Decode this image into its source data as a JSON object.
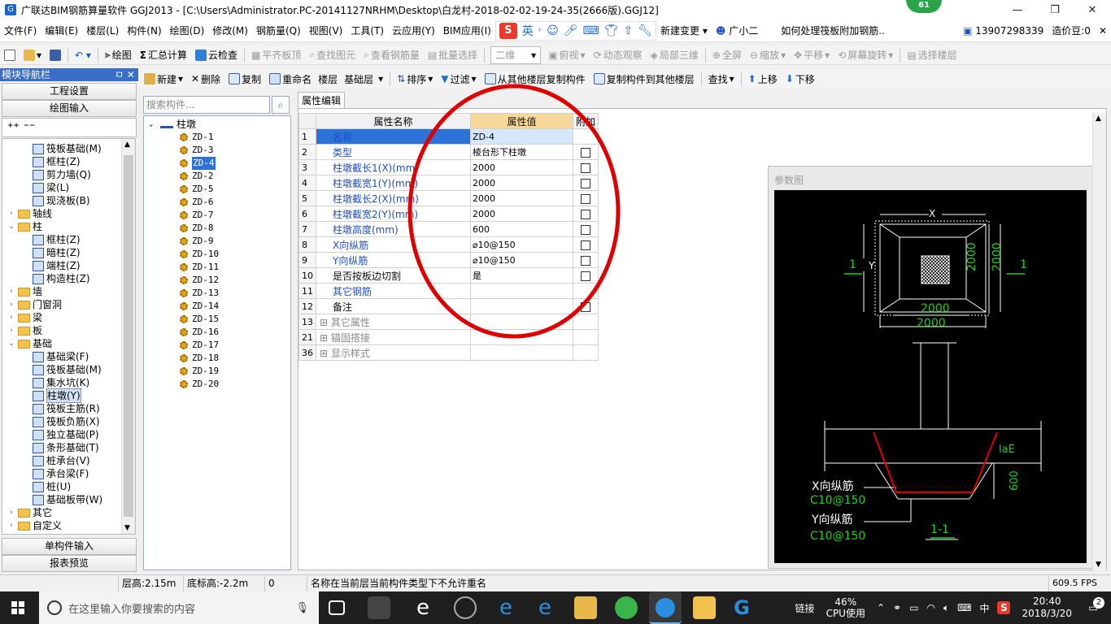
{
  "titlebar": {
    "title": "广联达BIM钢筋算量软件 GGJ2013 - [C:\\Users\\Administrator.PC-20141127NRHM\\Desktop\\白龙村-2018-02-02-19-24-35(2666版).GGJ12]",
    "badge": "61",
    "min": "—",
    "max": "❐",
    "close": "✕"
  },
  "menu": {
    "items": [
      "文件(F)",
      "编辑(E)",
      "楼层(L)",
      "构件(N)",
      "绘图(D)",
      "修改(M)",
      "钢筋量(Q)",
      "视图(V)",
      "工具(T)",
      "云应用(Y)",
      "BIM应用(I)"
    ],
    "ime_label": "英",
    "new_change": "新建变更",
    "assistant": "广小二",
    "question": "如何处理筏板附加钢筋..",
    "phone": "13907298339",
    "beans": "造价豆:0"
  },
  "toolbar1": {
    "draw": "绘图",
    "sum": "汇总计算",
    "cloud_check": "云检查",
    "flush": "平齐板顶",
    "find_elem": "查找图元",
    "view_rebar": "查看钢筋量",
    "batch_select": "批量选择",
    "view_mode": "二维",
    "top_view": "俯视",
    "dynamic": "动态观察",
    "local3d": "局部三维",
    "fullscreen": "全屏",
    "zoom": "缩放",
    "pan": "平移",
    "rotate": "屏幕旋转",
    "select_floor": "选择楼层"
  },
  "toolbar2": {
    "new": "新建",
    "delete": "删除",
    "copy": "复制",
    "rename": "重命名",
    "floor_label": "楼层",
    "floor_value": "基础层",
    "sort": "排序",
    "filter": "过滤",
    "copy_from": "从其他楼层复制构件",
    "copy_to": "复制构件到其他楼层",
    "find": "查找",
    "up": "上移",
    "down": "下移"
  },
  "nav": {
    "header": "模块导航栏",
    "pin": "ㅁ ✕",
    "project_settings": "工程设置",
    "drawing_input": "绘图输入",
    "single_input": "单构件输入",
    "report": "报表预览",
    "tree": [
      {
        "label": "筏板基础(M)",
        "level": 2,
        "kind": "item"
      },
      {
        "label": "框柱(Z)",
        "level": 2,
        "kind": "item"
      },
      {
        "label": "剪力墙(Q)",
        "level": 2,
        "kind": "item"
      },
      {
        "label": "梁(L)",
        "level": 2,
        "kind": "item"
      },
      {
        "label": "现浇板(B)",
        "level": 2,
        "kind": "item"
      },
      {
        "label": "轴线",
        "level": 1,
        "kind": "folder",
        "exp": "›"
      },
      {
        "label": "柱",
        "level": 1,
        "kind": "folder",
        "exp": "⌄"
      },
      {
        "label": "框柱(Z)",
        "level": 2,
        "kind": "item"
      },
      {
        "label": "暗柱(Z)",
        "level": 2,
        "kind": "item"
      },
      {
        "label": "端柱(Z)",
        "level": 2,
        "kind": "item"
      },
      {
        "label": "构造柱(Z)",
        "level": 2,
        "kind": "item"
      },
      {
        "label": "墙",
        "level": 1,
        "kind": "folder",
        "exp": "›"
      },
      {
        "label": "门窗洞",
        "level": 1,
        "kind": "folder",
        "exp": "›"
      },
      {
        "label": "梁",
        "level": 1,
        "kind": "folder",
        "exp": "›"
      },
      {
        "label": "板",
        "level": 1,
        "kind": "folder",
        "exp": "›"
      },
      {
        "label": "基础",
        "level": 1,
        "kind": "folder",
        "exp": "⌄"
      },
      {
        "label": "基础梁(F)",
        "level": 2,
        "kind": "item"
      },
      {
        "label": "筏板基础(M)",
        "level": 2,
        "kind": "item"
      },
      {
        "label": "集水坑(K)",
        "level": 2,
        "kind": "item"
      },
      {
        "label": "柱墩(Y)",
        "level": 2,
        "kind": "item",
        "selected": true
      },
      {
        "label": "筏板主筋(R)",
        "level": 2,
        "kind": "item"
      },
      {
        "label": "筏板负筋(X)",
        "level": 2,
        "kind": "item"
      },
      {
        "label": "独立基础(P)",
        "level": 2,
        "kind": "item"
      },
      {
        "label": "条形基础(T)",
        "level": 2,
        "kind": "item"
      },
      {
        "label": "桩承台(V)",
        "level": 2,
        "kind": "item"
      },
      {
        "label": "承台梁(F)",
        "level": 2,
        "kind": "item"
      },
      {
        "label": "桩(U)",
        "level": 2,
        "kind": "item"
      },
      {
        "label": "基础板带(W)",
        "level": 2,
        "kind": "item"
      },
      {
        "label": "其它",
        "level": 1,
        "kind": "folder",
        "exp": "›"
      },
      {
        "label": "自定义",
        "level": 1,
        "kind": "folder",
        "exp": "›"
      }
    ]
  },
  "components": {
    "search_placeholder": "搜索构件...",
    "root": "柱墩",
    "items": [
      "ZD-1",
      "ZD-3",
      "ZD-4",
      "ZD-2",
      "ZD-5",
      "ZD-6",
      "ZD-7",
      "ZD-8",
      "ZD-9",
      "ZD-10",
      "ZD-11",
      "ZD-12",
      "ZD-13",
      "ZD-14",
      "ZD-15",
      "ZD-16",
      "ZD-17",
      "ZD-18",
      "ZD-19",
      "ZD-20"
    ],
    "selected": "ZD-4"
  },
  "properties": {
    "tab": "属性编辑",
    "headers": {
      "name": "属性名称",
      "value": "属性值",
      "extra": "附加"
    },
    "rows": [
      {
        "no": "1",
        "name": "名称",
        "value": "ZD-4",
        "check": false,
        "selected": true
      },
      {
        "no": "2",
        "name": "类型",
        "value": "棱台形下柱墩",
        "check": true
      },
      {
        "no": "3",
        "name": "柱墩截长1(X)(mm)",
        "value": "2000",
        "check": true
      },
      {
        "no": "4",
        "name": "柱墩截宽1(Y)(mm)",
        "value": "2000",
        "check": true
      },
      {
        "no": "5",
        "name": "柱墩截长2(X)(mm)",
        "value": "2000",
        "check": true
      },
      {
        "no": "6",
        "name": "柱墩截宽2(Y)(mm)",
        "value": "2000",
        "check": true
      },
      {
        "no": "7",
        "name": "柱墩高度(mm)",
        "value": "600",
        "check": true
      },
      {
        "no": "8",
        "name": "X向纵筋",
        "value": "⌀10@150",
        "check": true
      },
      {
        "no": "9",
        "name": "Y向纵筋",
        "value": "⌀10@150",
        "check": true
      },
      {
        "no": "10",
        "name": "是否按板边切割",
        "value": "是",
        "check": true,
        "dark": true
      },
      {
        "no": "11",
        "name": "其它钢筋",
        "value": "",
        "check": false
      },
      {
        "no": "12",
        "name": "备注",
        "value": "",
        "check": true,
        "dark": true
      },
      {
        "no": "13",
        "name": "其它属性",
        "value": "",
        "check": false,
        "group": true
      },
      {
        "no": "21",
        "name": "锚固搭接",
        "value": "",
        "check": false,
        "group": true
      },
      {
        "no": "36",
        "name": "显示样式",
        "value": "",
        "check": false,
        "group": true
      }
    ]
  },
  "param_figure": {
    "title": "参数图",
    "labels": {
      "x": "X",
      "y": "Y",
      "sec_left": "1",
      "sec_right": "1",
      "dim_vert1": "2000",
      "dim_vert2": "2000",
      "dim_h1": "2000",
      "dim_h2": "2000",
      "lae": "laE",
      "h600": "600",
      "x_rebar": "X向纵筋",
      "x_spec": "C10@150",
      "y_rebar": "Y向纵筋",
      "y_spec": "C10@150",
      "section": "1-1"
    }
  },
  "status": {
    "floor_h": "层高:2.15m",
    "bottom_h": "底标高:-2.2m",
    "zero": "0",
    "message": "名称在当前层当前构件类型下不允许重名",
    "fps": "609.5 FPS"
  },
  "taskbar": {
    "search_placeholder": "在这里输入你要搜索的内容",
    "link": "链接",
    "cpu_pct": "46%",
    "cpu_label": "CPU使用",
    "lang": "中",
    "time": "20:40",
    "date": "2018/3/20",
    "notif": "2"
  },
  "colors": {
    "accent_blue": "#2c72d8",
    "header_value": "#f5d89a",
    "annotation_red": "#e00000",
    "cad_green": "#19d219"
  }
}
